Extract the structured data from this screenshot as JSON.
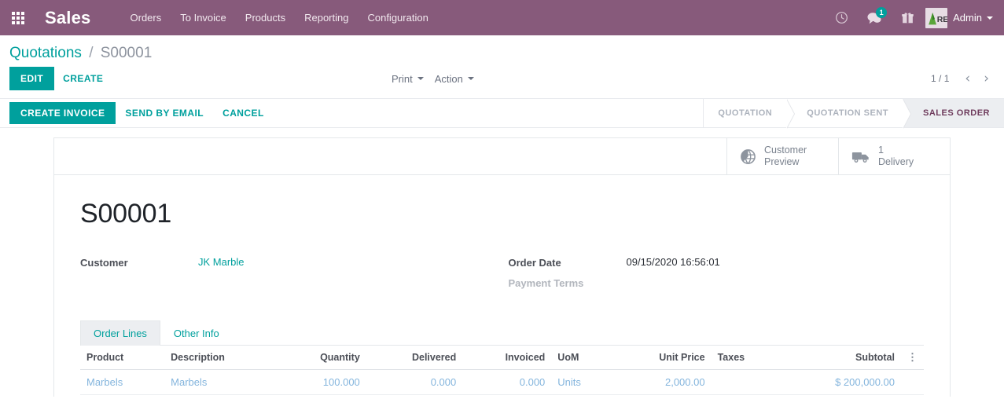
{
  "navbar": {
    "apps_icon": "apps-grid-icon",
    "brand": "Sales",
    "menu": [
      {
        "label": "Orders"
      },
      {
        "label": "To Invoice"
      },
      {
        "label": "Products"
      },
      {
        "label": "Reporting"
      },
      {
        "label": "Configuration"
      }
    ],
    "icons": {
      "activity": "clock-icon",
      "messages": "chat-bubble-icon",
      "messages_count": "1",
      "gift": "gift-icon"
    },
    "user": {
      "name": "Admin",
      "avatar": "user-avatar-logo"
    },
    "background_color": "#875A7B"
  },
  "control_panel": {
    "breadcrumb": {
      "root": "Quotations",
      "separator": "/",
      "current": "S00001"
    },
    "buttons": {
      "edit": "EDIT",
      "create": "CREATE"
    },
    "dropdowns": {
      "print": "Print",
      "action": "Action"
    },
    "pager": {
      "value": "1 / 1",
      "prev_icon": "chevron-left-icon",
      "next_icon": "chevron-right-icon"
    }
  },
  "statusbar": {
    "actions": [
      {
        "label": "CREATE INVOICE",
        "style": "primary"
      },
      {
        "label": "SEND BY EMAIL",
        "style": "link"
      },
      {
        "label": "CANCEL",
        "style": "link"
      }
    ],
    "stages": [
      {
        "label": "QUOTATION",
        "active": false
      },
      {
        "label": "QUOTATION SENT",
        "active": false
      },
      {
        "label": "SALES ORDER",
        "active": true
      }
    ],
    "active_color": "#6e3b5c"
  },
  "sheet": {
    "smart_buttons": [
      {
        "icon": "globe-icon",
        "line1": "Customer",
        "line2": "Preview"
      },
      {
        "icon": "truck-icon",
        "line1": "1",
        "line2": "Delivery"
      }
    ],
    "title": "S00001",
    "fields_left": [
      {
        "label": "Customer",
        "value": "JK Marble",
        "is_link": true
      }
    ],
    "fields_right": [
      {
        "label": "Order Date",
        "value": "09/15/2020 16:56:01",
        "is_link": false,
        "muted_label": false
      },
      {
        "label": "Payment Terms",
        "value": "",
        "is_link": false,
        "muted_label": true
      }
    ],
    "tabs": [
      {
        "label": "Order Lines",
        "active": true
      },
      {
        "label": "Other Info",
        "active": false
      }
    ],
    "table": {
      "columns": [
        {
          "label": "Product",
          "align": "left"
        },
        {
          "label": "Description",
          "align": "left"
        },
        {
          "label": "Quantity",
          "align": "right"
        },
        {
          "label": "Delivered",
          "align": "right"
        },
        {
          "label": "Invoiced",
          "align": "right"
        },
        {
          "label": "UoM",
          "align": "left"
        },
        {
          "label": "Unit Price",
          "align": "right"
        },
        {
          "label": "Taxes",
          "align": "left"
        },
        {
          "label": "Subtotal",
          "align": "right"
        }
      ],
      "options_icon": "vertical-dots-icon",
      "rows": [
        {
          "product": "Marbels",
          "description": "Marbels",
          "quantity": "100.000",
          "delivered": "0.000",
          "invoiced": "0.000",
          "uom": "Units",
          "unit_price": "2,000.00",
          "taxes": "",
          "subtotal": "$ 200,000.00"
        }
      ]
    }
  },
  "theme": {
    "brand_purple": "#875A7B",
    "accent_teal": "#00A09D",
    "link_blue": "#84b5dd"
  }
}
